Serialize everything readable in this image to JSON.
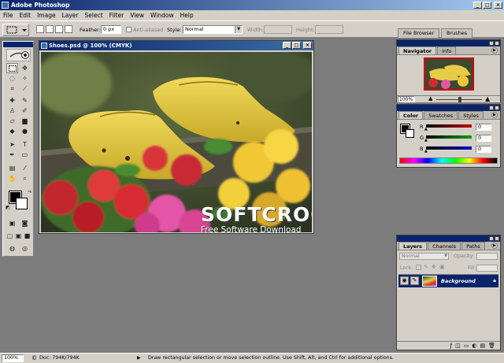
{
  "window": {
    "title": "Adobe Photoshop"
  },
  "menu": [
    "File",
    "Edit",
    "Image",
    "Layer",
    "Select",
    "Filter",
    "View",
    "Window",
    "Help"
  ],
  "options": {
    "feather_label": "Feather:",
    "feather_value": "0 px",
    "antialiased_label": "Anti-aliased",
    "style_label": "Style:",
    "style_value": "Normal",
    "width_label": "Width:",
    "height_label": "Height:",
    "well_tabs": [
      "File Browser",
      "Brushes"
    ]
  },
  "document": {
    "title": "Shoes.psd @ 100% (CMYK)",
    "watermark_title": "SOFTCROCO",
    "watermark_subtitle": "Free Software Download"
  },
  "navigator": {
    "tabs": [
      "Navigator",
      "Info"
    ],
    "zoom": "100%"
  },
  "color_panel": {
    "tabs": [
      "Color",
      "Swatches",
      "Styles"
    ],
    "channels": [
      {
        "label": "R",
        "value": "0",
        "color": "#c00000"
      },
      {
        "label": "G",
        "value": "0",
        "color": "#00a000"
      },
      {
        "label": "B",
        "value": "0",
        "color": "#0000c0"
      }
    ]
  },
  "layers": {
    "tabs": [
      "Layers",
      "Channels",
      "Paths"
    ],
    "blend_mode": "Normal",
    "opacity_label": "Opacity:",
    "lock_label": "Lock:",
    "fill_label": "Fill:",
    "layer_name": "Background"
  },
  "status": {
    "zoom": "100%",
    "doc_size": "Doc: 794K/794K",
    "hint": "Draw rectangular selection or move selection outline. Use Shift, Alt, and Ctrl for additional options."
  },
  "colors": {
    "titlebar": "#0a246a",
    "panel_bg": "#d4d0c8",
    "workspace": "#7c7c7c",
    "layer_selected": "#0a246a"
  }
}
